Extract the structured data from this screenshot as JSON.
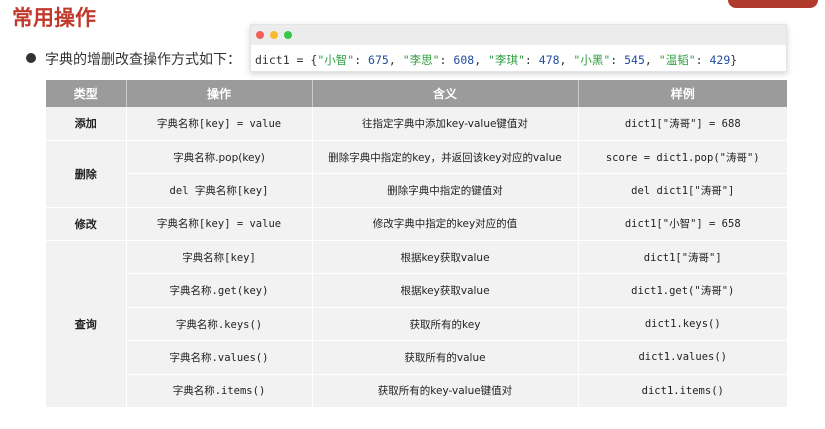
{
  "slide": {
    "title": "常用操作",
    "bullet": "字典的增删改查操作方式如下："
  },
  "code_window": {
    "var": "dict1",
    "op": " = {",
    "entries": [
      {
        "key": "\"小智\"",
        "value": "675"
      },
      {
        "key": "\"李思\"",
        "value": "608"
      },
      {
        "key": "\"李琪\"",
        "value": "478"
      },
      {
        "key": "\"小黑\"",
        "value": "545"
      },
      {
        "key": "\"温韬\"",
        "value": "429"
      }
    ],
    "close": "}"
  },
  "table": {
    "headers": {
      "type": "类型",
      "operation": "操作",
      "meaning": "含义",
      "example": "样例"
    },
    "groups": {
      "add": "添加",
      "delete": "删除",
      "modify": "修改",
      "query": "查询"
    },
    "rows": [
      {
        "operation": "字典名称[key] = value",
        "meaning": "往指定字典中添加key-value键值对",
        "example": "dict1[\"涛哥\"] = 688"
      },
      {
        "operation": "字典名称.pop(key)",
        "meaning": "删除字典中指定的key，并返回该key对应的value",
        "example": "score = dict1.pop(\"涛哥\")"
      },
      {
        "operation": "del 字典名称[key]",
        "meaning": "删除字典中指定的键值对",
        "example": "del dict1[\"涛哥\"]"
      },
      {
        "operation": "字典名称[key] = value",
        "meaning": "修改字典中指定的key对应的值",
        "example": "dict1[\"小智\"] = 658"
      },
      {
        "operation": "字典名称[key]",
        "meaning": "根据key获取value",
        "example": "dict1[\"涛哥\"]"
      },
      {
        "operation": "字典名称.get(key)",
        "meaning": "根据key获取value",
        "example": "dict1.get(\"涛哥\")"
      },
      {
        "operation": "字典名称.keys()",
        "meaning": "获取所有的key",
        "example": "dict1.keys()"
      },
      {
        "operation": "字典名称.values()",
        "meaning": "获取所有的value",
        "example": "dict1.values()"
      },
      {
        "operation": "字典名称.items()",
        "meaning": "获取所有的key-value键值对",
        "example": "dict1.items()"
      }
    ]
  },
  "colors": {
    "title_red": "#c0392b",
    "header_gray": "#9b9b9b",
    "row_bg": "#f2f2f2",
    "string_green": "#2f9e3f",
    "number_blue": "#1f4e9e"
  }
}
